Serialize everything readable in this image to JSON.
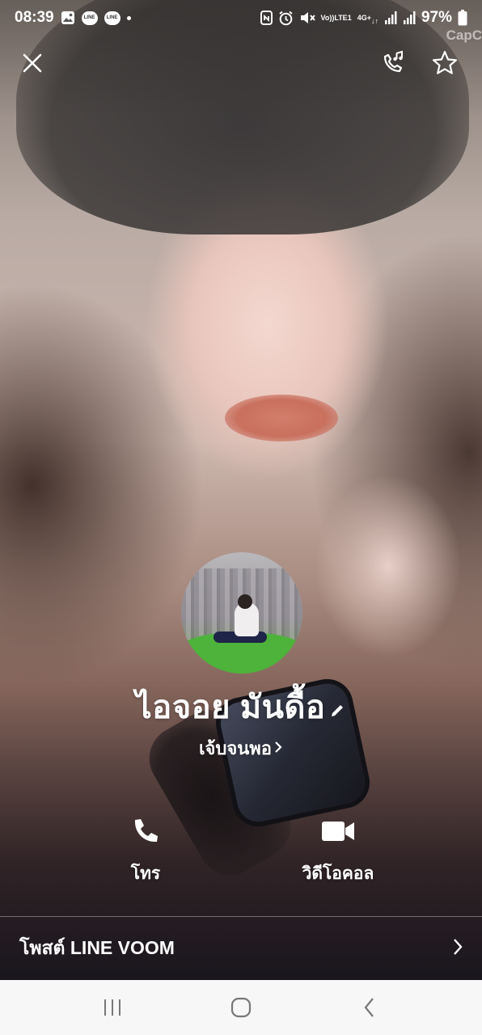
{
  "status_bar": {
    "time": "08:39",
    "notification_icons": [
      "gallery-icon",
      "line-icon",
      "line-icon",
      "dot-icon"
    ],
    "line_badge_text": "LINE",
    "system_icons": [
      "nfc-icon",
      "alarm-icon",
      "mute-icon",
      "volte-icon",
      "4g-icon",
      "signal-icon",
      "signal-icon",
      "battery-icon"
    ],
    "volte_top": "Vo))",
    "volte_bottom": "LTE1",
    "network_label": "4G+",
    "battery_percent": "97%",
    "overlay_text": "CapC"
  },
  "top_actions": {
    "close_icon": "close-icon",
    "call_music_icon": "phone-music-icon",
    "favorite_icon": "star-icon"
  },
  "profile": {
    "display_name": "ไอจอย มันดื้อ",
    "status_message": "เจ้บจนพอ"
  },
  "actions": [
    {
      "label": "โทร",
      "icon": "phone-icon"
    },
    {
      "label": "วิดีโอคอล",
      "icon": "video-camera-icon"
    }
  ],
  "voom": {
    "label": "โพสต์ LINE VOOM",
    "icon": "chevron-right-icon"
  },
  "nav": {
    "recents_icon": "recents-icon",
    "home_icon": "home-icon",
    "back_icon": "back-icon",
    "background_color": "#f7f7f7",
    "icon_color": "#777777"
  }
}
